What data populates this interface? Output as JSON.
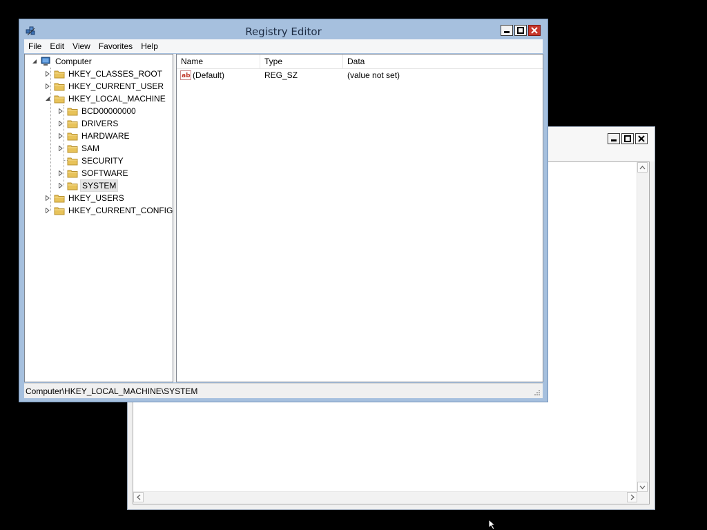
{
  "main_window": {
    "title": "Registry Editor",
    "menu": [
      "File",
      "Edit",
      "View",
      "Favorites",
      "Help"
    ],
    "tree": [
      {
        "label": "Computer",
        "level": 0,
        "state": "expanded"
      },
      {
        "label": "HKEY_CLASSES_ROOT",
        "level": 1,
        "state": "collapsed"
      },
      {
        "label": "HKEY_CURRENT_USER",
        "level": 1,
        "state": "collapsed"
      },
      {
        "label": "HKEY_LOCAL_MACHINE",
        "level": 1,
        "state": "expanded"
      },
      {
        "label": "BCD00000000",
        "level": 2,
        "state": "collapsed"
      },
      {
        "label": "DRIVERS",
        "level": 2,
        "state": "collapsed"
      },
      {
        "label": "HARDWARE",
        "level": 2,
        "state": "collapsed"
      },
      {
        "label": "SAM",
        "level": 2,
        "state": "collapsed"
      },
      {
        "label": "SECURITY",
        "level": 2,
        "state": "leaf"
      },
      {
        "label": "SOFTWARE",
        "level": 2,
        "state": "collapsed"
      },
      {
        "label": "SYSTEM",
        "level": 2,
        "state": "collapsed",
        "selected": true
      },
      {
        "label": "HKEY_USERS",
        "level": 1,
        "state": "collapsed"
      },
      {
        "label": "HKEY_CURRENT_CONFIG",
        "level": 1,
        "state": "collapsed"
      }
    ],
    "list": {
      "columns": [
        "Name",
        "Type",
        "Data"
      ],
      "rows": [
        {
          "name": "(Default)",
          "type": "REG_SZ",
          "data": "(value not set)"
        }
      ]
    },
    "status": "Computer\\HKEY_LOCAL_MACHINE\\SYSTEM"
  },
  "colors": {
    "desktop": "#000000",
    "title_bar": "#a6c0de",
    "close_button": "#c7372c",
    "folder": "#e8c35a"
  },
  "icons": {
    "app": "registry-editor-icon",
    "computer": "computer-icon",
    "folder": "folder-icon",
    "string_value": "string-value-icon"
  }
}
